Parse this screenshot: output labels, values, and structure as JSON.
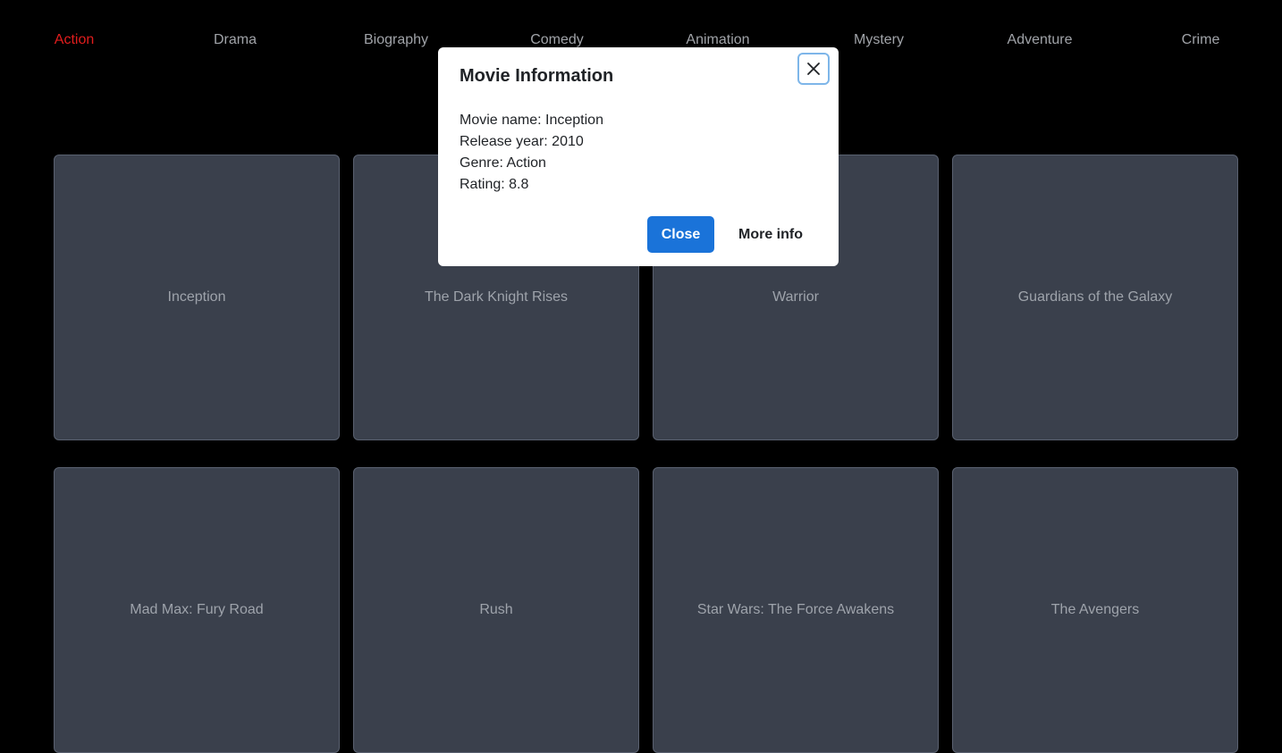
{
  "nav": {
    "items": [
      {
        "label": "Action",
        "active": true
      },
      {
        "label": "Drama"
      },
      {
        "label": "Biography"
      },
      {
        "label": "Comedy"
      },
      {
        "label": "Animation"
      },
      {
        "label": "Mystery"
      },
      {
        "label": "Adventure"
      },
      {
        "label": "Crime"
      }
    ],
    "active_color": "#e11d1d",
    "inactive_color": "#a0a3a8"
  },
  "movies": [
    "Inception",
    "The Dark Knight Rises",
    "Warrior",
    "Guardians of the Galaxy",
    "Mad Max: Fury Road",
    "Rush",
    "Star Wars: The Force Awakens",
    "The Avengers"
  ],
  "modal": {
    "title": "Movie Information",
    "details": [
      "Movie name: Inception",
      "Release year: 2010",
      "Genre: Action",
      "Rating: 8.8"
    ],
    "close_label": "Close",
    "more_label": "More info",
    "close_icon": "close-icon",
    "accent_color": "#1a73d9"
  }
}
